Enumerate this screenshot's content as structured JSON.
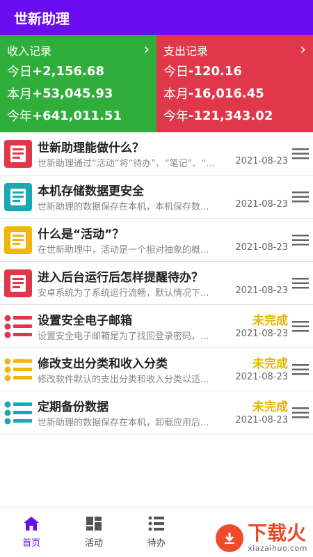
{
  "app": {
    "title": "世新助理"
  },
  "summary": {
    "income": {
      "title": "收入记录",
      "today_label": "今日",
      "today": "+2,156.68",
      "month_label": "本月",
      "month": "+53,045.93",
      "year_label": "今年",
      "year": "+641,011.51",
      "color": "#2fae3c"
    },
    "expense": {
      "title": "支出记录",
      "today_label": "今日",
      "today": "-120.16",
      "month_label": "本月",
      "month": "-16,016.45",
      "year_label": "今年",
      "year": "-121,343.02",
      "color": "#e0384a"
    }
  },
  "items": [
    {
      "title": "世新助理能做什么？",
      "subtitle": "世新助理通过“活动”将“待办”、“笔记”、“...",
      "date": "2021-08-23",
      "status": "",
      "icon": "note-icon",
      "color": "#e0384a"
    },
    {
      "title": "本机存储数据更安全",
      "subtitle": "世新助理的数据保存在本机，本机保存数...",
      "date": "2021-08-23",
      "status": "",
      "icon": "note-icon",
      "color": "#1ca7b5"
    },
    {
      "title": "什么是“活动”？",
      "subtitle": "在世新助理中，活动是一个相对抽象的概...",
      "date": "2021-08-23",
      "status": "",
      "icon": "note-icon",
      "color": "#f2b705"
    },
    {
      "title": "进入后台运行后怎样提醒待办？",
      "subtitle": "安卓系统为了系统运行流畅，默认情况下...",
      "date": "2021-08-23",
      "status": "",
      "icon": "note-icon",
      "color": "#e0384a"
    },
    {
      "title": "设置安全电子邮箱",
      "subtitle": "设置安全电子邮箱是为了找回登录密码，...",
      "date": "2021-08-23",
      "status": "未完成",
      "icon": "todo-list-icon",
      "color": "#e0384a"
    },
    {
      "title": "修改支出分类和收入分类",
      "subtitle": "修改软件默认的支出分类和收入分类以适...",
      "date": "2021-08-23",
      "status": "未完成",
      "icon": "todo-list-icon",
      "color": "#f2b705"
    },
    {
      "title": "定期备份数据",
      "subtitle": "世新助理的数据保存在本机，卸载应用后...",
      "date": "2021-08-23",
      "status": "未完成",
      "icon": "todo-list-icon",
      "color": "#1ca7b5"
    }
  ],
  "tabs": [
    {
      "label": "首页",
      "icon": "home-icon",
      "active": true
    },
    {
      "label": "活动",
      "icon": "grid-icon",
      "active": false
    },
    {
      "label": "待办",
      "icon": "list-icon",
      "active": false
    }
  ],
  "watermark": {
    "text": "下载火",
    "sub": "xiazaihuo.com"
  },
  "colors": {
    "accent": "#6a0dee",
    "status": "#e8b400"
  }
}
